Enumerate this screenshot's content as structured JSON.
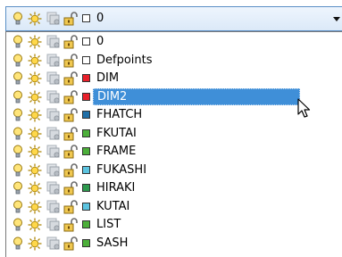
{
  "combo": {
    "selected_layer": "0",
    "selected_color": "#ffffff"
  },
  "layers": [
    {
      "name": "0",
      "color": "#ffffff",
      "selected": false
    },
    {
      "name": "Defpoints",
      "color": "#ffffff",
      "selected": false
    },
    {
      "name": "DIM",
      "color": "#e8202a",
      "selected": false
    },
    {
      "name": "DIM2",
      "color": "#e8202a",
      "selected": true
    },
    {
      "name": "FHATCH",
      "color": "#1f6fa8",
      "selected": false
    },
    {
      "name": "FKUTAI",
      "color": "#4caf3a",
      "selected": false
    },
    {
      "name": "FRAME",
      "color": "#4caf3a",
      "selected": false
    },
    {
      "name": "FUKASHI",
      "color": "#5cc4e0",
      "selected": false
    },
    {
      "name": "HIRAKI",
      "color": "#2e9a4e",
      "selected": false
    },
    {
      "name": "KUTAI",
      "color": "#5cc4e0",
      "selected": false
    },
    {
      "name": "LIST",
      "color": "#4caf3a",
      "selected": false
    },
    {
      "name": "SASH",
      "color": "#4caf3a",
      "selected": false
    }
  ],
  "icons": {
    "bulb": "lightbulb-on-icon",
    "sun": "sun-thaw-icon",
    "freeze": "viewport-freeze-icon",
    "lock": "padlock-unlocked-icon"
  }
}
